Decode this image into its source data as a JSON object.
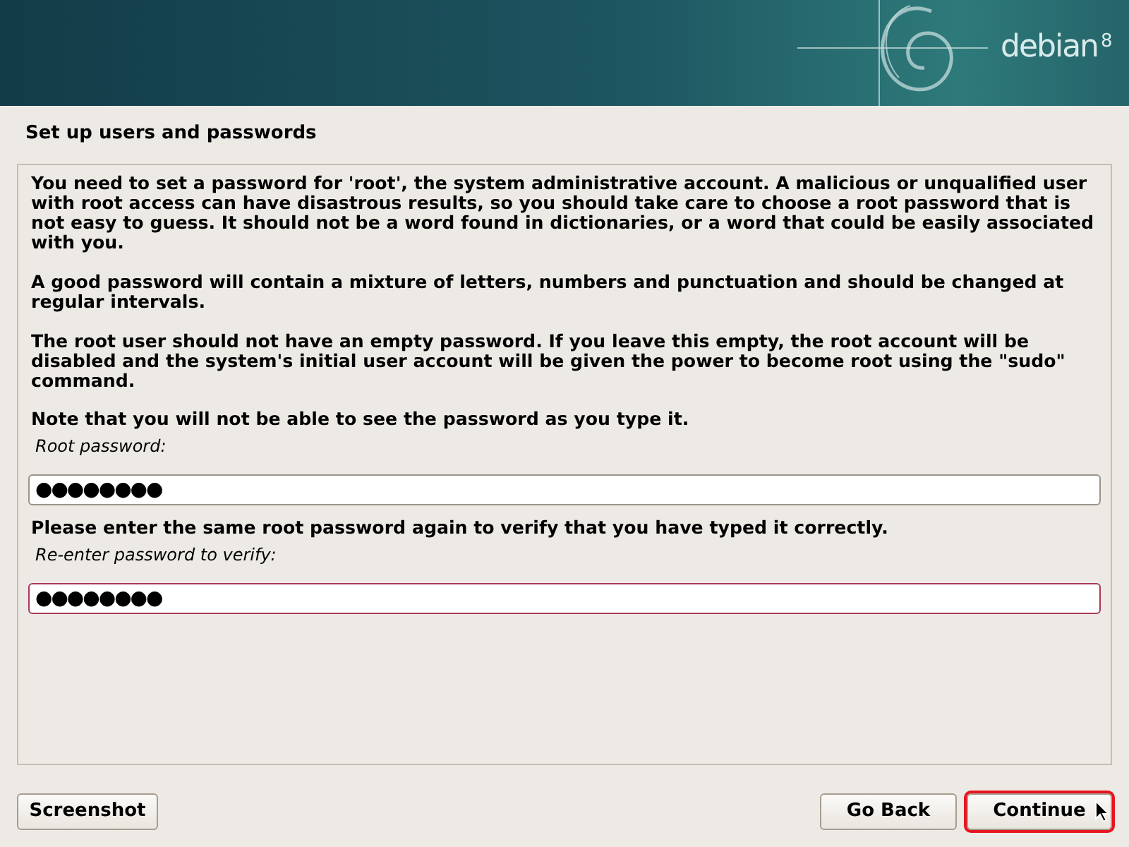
{
  "header": {
    "logo_text": "debian",
    "logo_version": "8"
  },
  "title": "Set up users and passwords",
  "paragraphs": [
    "You need to set a password for 'root', the system administrative account. A malicious or unqualified user with root access can have disastrous results, so you should take care to choose a root password that is not easy to guess. It should not be a word found in dictionaries, or a word that could be easily associated with you.",
    "A good password will contain a mixture of letters, numbers and punctuation and should be changed at regular intervals.",
    "The root user should not have an empty password. If you leave this empty, the root account will be disabled and the system's initial user account will be given the power to become root using the \"sudo\" command."
  ],
  "fields": [
    {
      "prompt": "Note that you will not be able to see the password as you type it.",
      "label": "Root password:",
      "value": "●●●●●●●●",
      "focused": false
    },
    {
      "prompt": "Please enter the same root password again to verify that you have typed it correctly.",
      "label": "Re-enter password to verify:",
      "value": "●●●●●●●●",
      "focused": true
    }
  ],
  "buttons": [
    {
      "label": "Screenshot",
      "focused": false
    },
    {
      "label": "Go Back",
      "focused": false
    },
    {
      "label": "Continue",
      "focused": true
    }
  ]
}
